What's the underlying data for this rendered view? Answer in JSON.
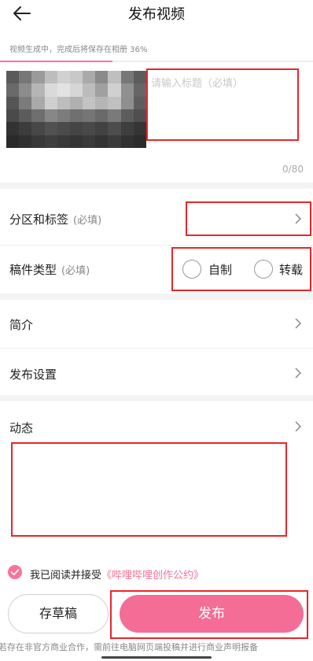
{
  "header": {
    "title": "发布视频",
    "back_icon": "arrow-left-icon"
  },
  "progress": {
    "text": "视频生成中，完成后将保存在相册 36%",
    "percent": 36,
    "color": "#fb7299"
  },
  "cover": {
    "thumbnail": "pixelated-video-thumbnail"
  },
  "title_field": {
    "placeholder": "请输入标题（必填）",
    "counter": "0/80"
  },
  "rows": {
    "category": {
      "label": "分区和标签",
      "required": "(必填)"
    },
    "type": {
      "label": "稿件类型",
      "required": "(必填)",
      "options": [
        "自制",
        "转载"
      ]
    },
    "intro": {
      "label": "简介"
    },
    "settings": {
      "label": "发布设置"
    },
    "dynamic": {
      "label": "动态"
    }
  },
  "agreement": {
    "prefix": "我已阅读并接受",
    "link": "《哔哩哔哩创作公约》",
    "checked": true
  },
  "buttons": {
    "draft": "存草稿",
    "publish": "发布"
  },
  "notice": "若存在非官方商业合作，需前往电脑网页端投稿并进行商业声明报备",
  "colors": {
    "accent": "#fb7299",
    "annotation": "#e8262a"
  }
}
